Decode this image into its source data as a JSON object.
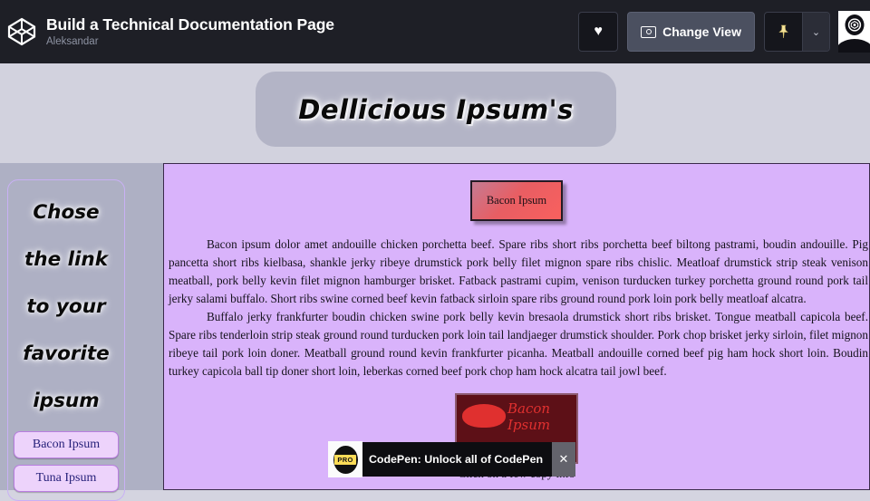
{
  "header": {
    "logo_icon": "codepen-logo-icon",
    "title": "Build a Technical Documentation Page",
    "author": "Aleksandar",
    "heart_icon": "♥",
    "change_view_label": "Change View",
    "change_view_icon": "layout-view-icon",
    "pin_icon": "📌",
    "caret_icon": "⌄",
    "avatar_alt": "user-avatar"
  },
  "page": {
    "banner_title": "Dellicious Ipsum's"
  },
  "sidebar": {
    "heading": "Chose the link to your favorite ipsum",
    "links": [
      {
        "label": "Bacon Ipsum"
      },
      {
        "label": "Tuna Ipsum"
      }
    ]
  },
  "main": {
    "section_header": "Bacon Ipsum",
    "paragraphs": [
      "Bacon ipsum dolor amet andouille chicken porchetta beef. Spare ribs short ribs porchetta beef biltong pastrami, boudin andouille. Pig pancetta short ribs kielbasa, shankle jerky ribeye drumstick pork belly filet mignon spare ribs chislic. Meatloaf drumstick strip steak venison meatball, pork belly kevin filet mignon hamburger brisket. Fatback pastrami cupim, venison turducken turkey porchetta ground round pork tail jerky salami buffalo. Short ribs swine corned beef kevin fatback sirloin spare ribs ground round pork loin pork belly meatloaf alcatra.",
      "Buffalo jerky frankfurter boudin chicken swine pork belly kevin bresaola drumstick short ribs brisket. Tongue meatball capicola beef. Spare ribs tenderloin strip steak ground round turducken pork loin tail landjaeger drumstick shoulder. Pork chop brisket jerky sirloin, filet mignon ribeye tail pork loin doner. Meatball ground round kevin frankfurter picanha. Meatball andouille corned beef pig ham hock short loin. Boudin turkey capicola ball tip doner short loin, leberkas corned beef pork chop ham hock alcatra tail jowl beef."
    ],
    "image_script_text": "Bacon Ipsum",
    "image_caption": "Click on a few  copy info"
  },
  "ad": {
    "badge": "PRO",
    "text": "CodePen: Unlock all of CodePen",
    "close_icon": "✕"
  },
  "colors": {
    "topbar_bg": "#1e1f26",
    "banner_bg": "#b3b4c6",
    "sidebar_bg": "#aeb0c4",
    "main_bg": "#d9b3fb",
    "link_bg": "#edd3fb",
    "link_border": "#b97ee0",
    "header_gradient_end": "#f9605e",
    "ad_bg": "#0d0d11"
  }
}
